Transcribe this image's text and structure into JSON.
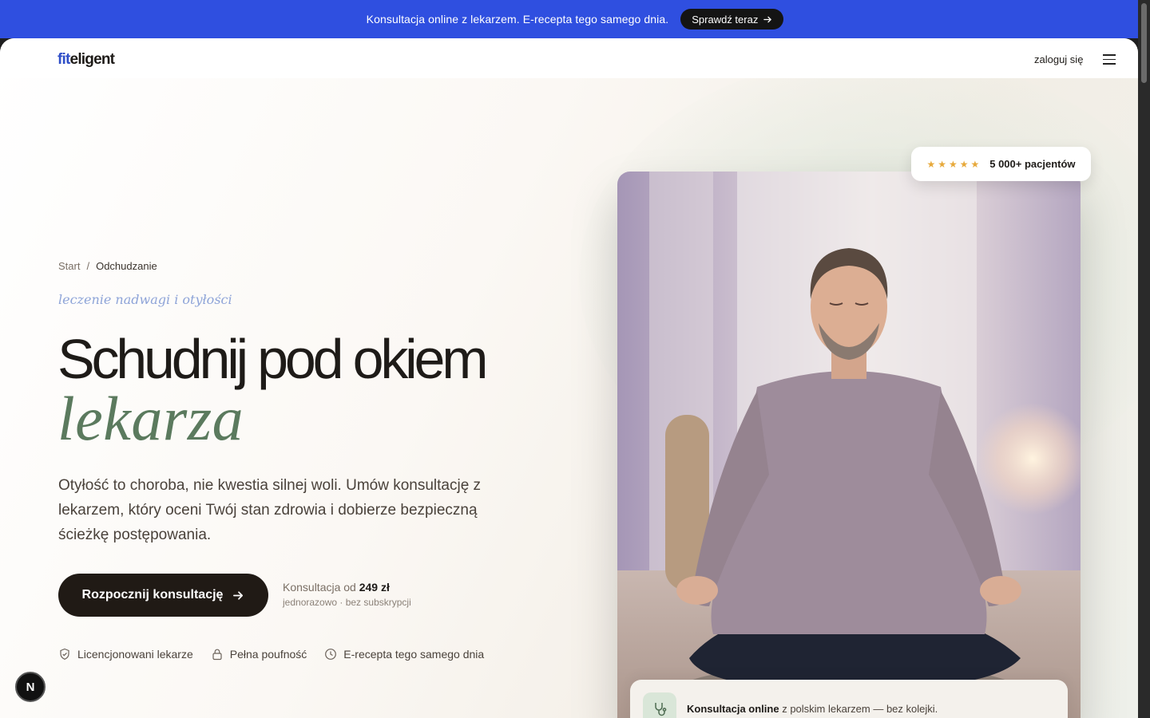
{
  "promo": {
    "text": "Konsultacja online z lekarzem. E-recepta tego samego dnia.",
    "button_label": "Sprawdź teraz",
    "background": "#2f4fe0"
  },
  "header": {
    "logo_part1": "fit",
    "logo_part2": "eligent",
    "login_label": "zaloguj się",
    "menu_icon": "hamburger-icon"
  },
  "breadcrumb": {
    "items": [
      "Start",
      "Odchudzanie"
    ],
    "separator": "/"
  },
  "hero": {
    "kicker": "leczenie nadwagi i otyłości",
    "headline": "Schudnij pod okiem",
    "headline_em": "lekarza",
    "lead": "Otyłość to choroba, nie kwestia silnej woli. Umów konsultację z lekarzem, który oceni Twój stan zdrowia i dobierze bezpieczną ścieżkę postępowania.",
    "cta_label": "Rozpocznij konsultację",
    "price_prefix": "Konsultacja od",
    "price_value": "249 zł",
    "price_sub": "jednorazowo · bez subskrypcji",
    "accent_color": "#5b7a5e"
  },
  "trust": [
    {
      "label": "Licencjonowani lekarze",
      "icon": "shield-check-icon"
    },
    {
      "label": "Pełna poufność",
      "icon": "lock-icon"
    },
    {
      "label": "E-recepta tego samego dnia",
      "icon": "clock-icon"
    }
  ],
  "rating": {
    "stars": 5,
    "text": "5 000+ pacjentów"
  },
  "consult_card": {
    "bold": "Konsultacja online",
    "rest": "z polskim lekarzem — bez kolejki.",
    "icon": "stethoscope-icon"
  },
  "badge": {
    "letter": "N"
  }
}
